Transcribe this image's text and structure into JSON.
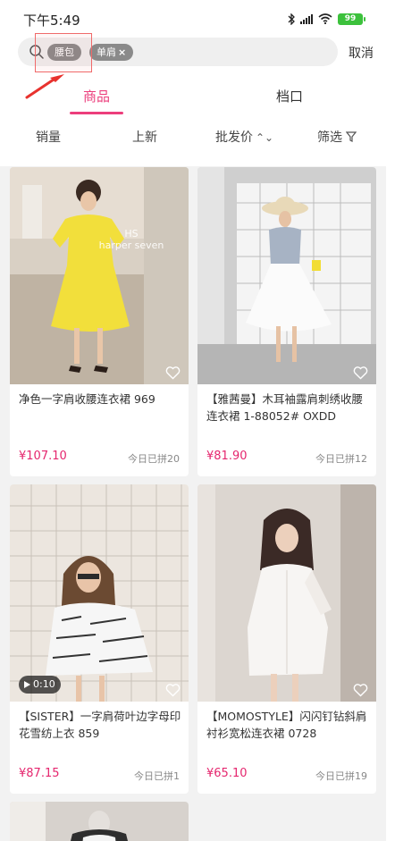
{
  "status_bar": {
    "time": "下午5:49",
    "battery": "99"
  },
  "search": {
    "chips": [
      "腰包",
      "单肩"
    ],
    "chip_close_glyph": "×",
    "cancel_label": "取消"
  },
  "tabs": [
    {
      "label": "商品",
      "active": true
    },
    {
      "label": "档口",
      "active": false
    }
  ],
  "sort_bar": {
    "items": [
      "销量",
      "上新",
      "批发价",
      "筛选"
    ]
  },
  "products": [
    {
      "title": "净色一字肩收腰连衣裙 969",
      "price": "¥107.10",
      "sold": "今日已拼20",
      "image_caption": "HS\nharper seven",
      "has_video": false
    },
    {
      "title": "【雅茜曼】木耳袖露肩刺绣收腰连衣裙 1-88052# OXDD",
      "price": "¥81.90",
      "sold": "今日已拼12",
      "has_video": false
    },
    {
      "title": "【SISTER】一字肩荷叶边字母印花雪纺上衣 859",
      "price": "¥87.15",
      "sold": "今日已拼1",
      "has_video": true,
      "video_duration": "0:10"
    },
    {
      "title": "【MOMOSTYLE】闪闪钉钻斜肩衬衫宽松连衣裙 0728",
      "price": "¥65.10",
      "sold": "今日已拼19",
      "has_video": false
    }
  ],
  "colors": {
    "accent": "#ec3e7c",
    "price": "#e5266e"
  }
}
